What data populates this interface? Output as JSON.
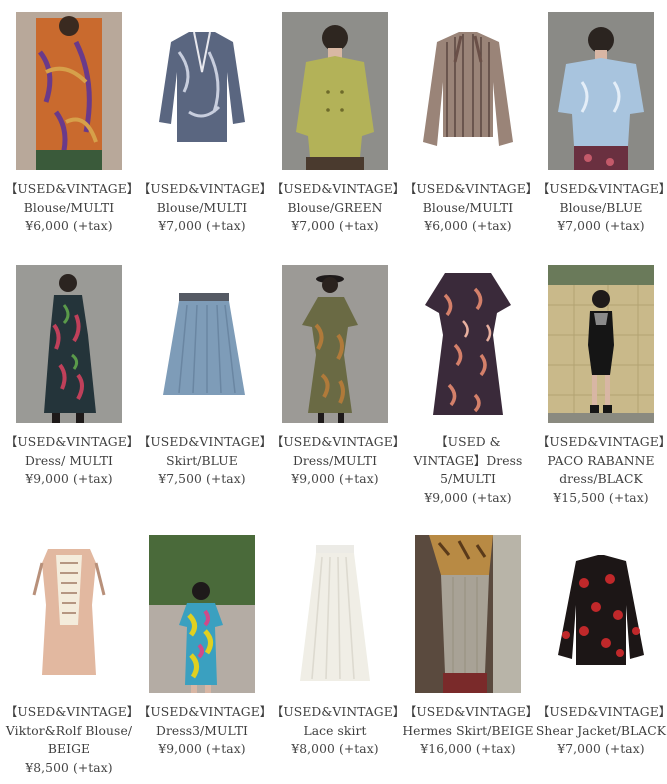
{
  "products": [
    {
      "name": "【USED&VINTAGE】Blouse/MULTI",
      "price": "¥6,000 (+tax)"
    },
    {
      "name": "【USED&VINTAGE】Blouse/MULTI",
      "price": "¥7,000 (+tax)"
    },
    {
      "name": "【USED&VINTAGE】Blouse/GREEN",
      "price": "¥7,000 (+tax)"
    },
    {
      "name": "【USED&VINTAGE】Blouse/MULTI",
      "price": "¥6,000 (+tax)"
    },
    {
      "name": "【USED&VINTAGE】Blouse/BLUE",
      "price": "¥7,000 (+tax)"
    },
    {
      "name": "【USED&VINTAGE】Dress/ MULTI",
      "price": "¥9,000 (+tax)"
    },
    {
      "name": "【USED&VINTAGE】Skirt/BLUE",
      "price": "¥7,500 (+tax)"
    },
    {
      "name": "【USED&VINTAGE】Dress/MULTI",
      "price": "¥9,000 (+tax)"
    },
    {
      "name": "【USED & VINTAGE】Dress 5/MULTI",
      "price": "¥9,000 (+tax)"
    },
    {
      "name": "【USED&VINTAGE】PACO RABANNE dress/BLACK",
      "price": "¥15,500 (+tax)"
    },
    {
      "name": "【USED&VINTAGE】Viktor&Rolf Blouse/ BEIGE",
      "price": "¥8,500 (+tax)"
    },
    {
      "name": "【USED&VINTAGE】Dress3/MULTI",
      "price": "¥9,000 (+tax)"
    },
    {
      "name": "【USED&VINTAGE】Lace skirt",
      "price": "¥8,000 (+tax)"
    },
    {
      "name": "【USED&VINTAGE】Hermes Skirt/BEIGE",
      "price": "¥16,000 (+tax)"
    },
    {
      "name": "【USED&VINTAGE】Shear Jacket/BLACK",
      "price": "¥7,000 (+tax)"
    }
  ]
}
